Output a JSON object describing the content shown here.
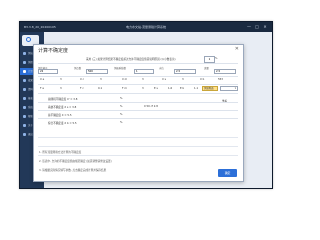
{
  "window": {
    "left_title": "B3.3.8_20_20200105",
    "center_title": "电力水文站-流量测验计算系统",
    "minimize": "—",
    "maximize": "□",
    "close": "✕"
  },
  "sidebar": {
    "items": [
      {
        "label": "测站信息"
      },
      {
        "label": "测验管理"
      },
      {
        "label": "计算管理"
      },
      {
        "label": "成果管理"
      },
      {
        "label": "资料整编"
      },
      {
        "label": "报表管理"
      },
      {
        "label": "系统设置"
      },
      {
        "label": "帮助"
      },
      {
        "label": "关于"
      },
      {
        "label": "退出"
      }
    ]
  },
  "dialog": {
    "title": "计算不确定度",
    "close": "✕",
    "header_text": "采用 (三) 如果计算结果不确定度超过允许不确定度值需说明原因 (以小数表示)",
    "header_value": "1",
    "header_after": "%",
    "row1": {
      "l1": "测次编号",
      "v1": "22",
      "l2": "测点数",
      "v2": "500",
      "l3": "测速垂线数",
      "v3": "1",
      "l4": "水位",
      "v4": "2.5",
      "l5": "流量",
      "v5": "2.5"
    },
    "row2": {
      "l1": "X e",
      "v1": "3",
      "l2": "X c",
      "v2": "3",
      "l3": "X m",
      "v3": "3",
      "l4": "X s",
      "v4": "3",
      "l5": "X b",
      "v5": "553"
    },
    "row3": {
      "l1": "F e",
      "v1": "3",
      "l2": "F c",
      "v2": "0.1",
      "l3": "F m",
      "v3": "3",
      "l4": "E s",
      "v4": "1.6",
      "l5": "E b",
      "v5": "1.1",
      "hl": "测流断面",
      "sel": "坐标"
    },
    "results": [
      {
        "label": "总随机不确定度 X' = 3.8",
        "unit": "%"
      },
      {
        "label": "系统不确定度 X s = 3.8",
        "unit": "%",
        "extra": "0    50 cf    2.8"
      },
      {
        "label": "总不确定度 X = 5.5",
        "unit": "%"
      },
      {
        "label": "综合不确定度 X b = 5.5",
        "unit": "%"
      }
    ],
    "notes": [
      "1. 所有流量测验方法计算的不确定度",
      "2. 该表中, 允许的不确定度值由规范确定 (如需调整请修改设置)",
      "3. 请根据实际情况填写参数, 点击确定完成计算并保存结果"
    ],
    "confirm_label": "确定"
  }
}
